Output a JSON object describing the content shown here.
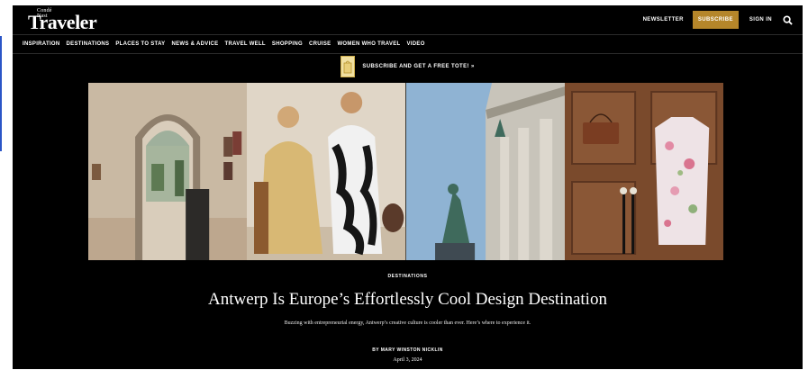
{
  "header": {
    "logo_small": "Condé Nast",
    "logo_big": "Traveler",
    "newsletter": "NEWSLETTER",
    "subscribe": "SUBSCRIBE",
    "sign_in": "SIGN IN"
  },
  "nav": {
    "items": [
      "INSPIRATION",
      "DESTINATIONS",
      "PLACES TO STAY",
      "NEWS & ADVICE",
      "TRAVEL WELL",
      "SHOPPING",
      "CRUISE",
      "WOMEN WHO TRAVEL",
      "VIDEO"
    ]
  },
  "promo": {
    "text": "SUBSCRIBE AND GET A FREE TOTE! »"
  },
  "article": {
    "kicker": "DESTINATIONS",
    "headline": "Antwerp Is Europe’s Effortlessly Cool Design Destination",
    "dek": "Buzzing with entrepreneurial energy, Antwerp’s creative culture is cooler than ever. Here’s where to experience it.",
    "byline": "BY MARY WINSTON NICKLIN",
    "date": "April 3, 2024"
  },
  "colors": {
    "background": "#000000",
    "accent": "#b5862a",
    "text": "#ffffff"
  },
  "icons": {
    "search": "search-icon",
    "promo": "tote-bag-icon"
  }
}
